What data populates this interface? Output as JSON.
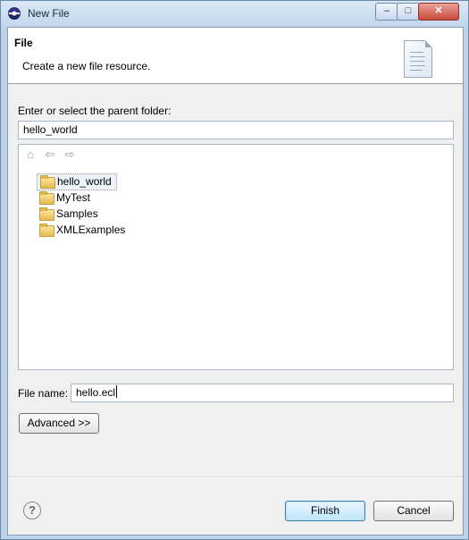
{
  "window": {
    "title": "New File"
  },
  "banner": {
    "title": "File",
    "description": "Create a new file resource."
  },
  "parent_folder": {
    "label": "Enter or select the parent folder:",
    "value": "hello_world"
  },
  "tree": {
    "toolbar": {
      "home_icon": "house-icon",
      "back_icon": "arrow-left-icon",
      "forward_icon": "arrow-right-icon"
    },
    "items": [
      {
        "label": "hello_world",
        "selected": true
      },
      {
        "label": "MyTest",
        "selected": false
      },
      {
        "label": "Samples",
        "selected": false
      },
      {
        "label": "XMLExamples",
        "selected": false
      }
    ]
  },
  "file_name": {
    "label": "File name:",
    "value": "hello.ecl"
  },
  "buttons": {
    "advanced": "Advanced >>",
    "finish": "Finish",
    "cancel": "Cancel"
  },
  "colors": {
    "default_button": "#bde6fd",
    "titlebar": "#c3d7ee",
    "client_bg": "#f0f0f0"
  }
}
